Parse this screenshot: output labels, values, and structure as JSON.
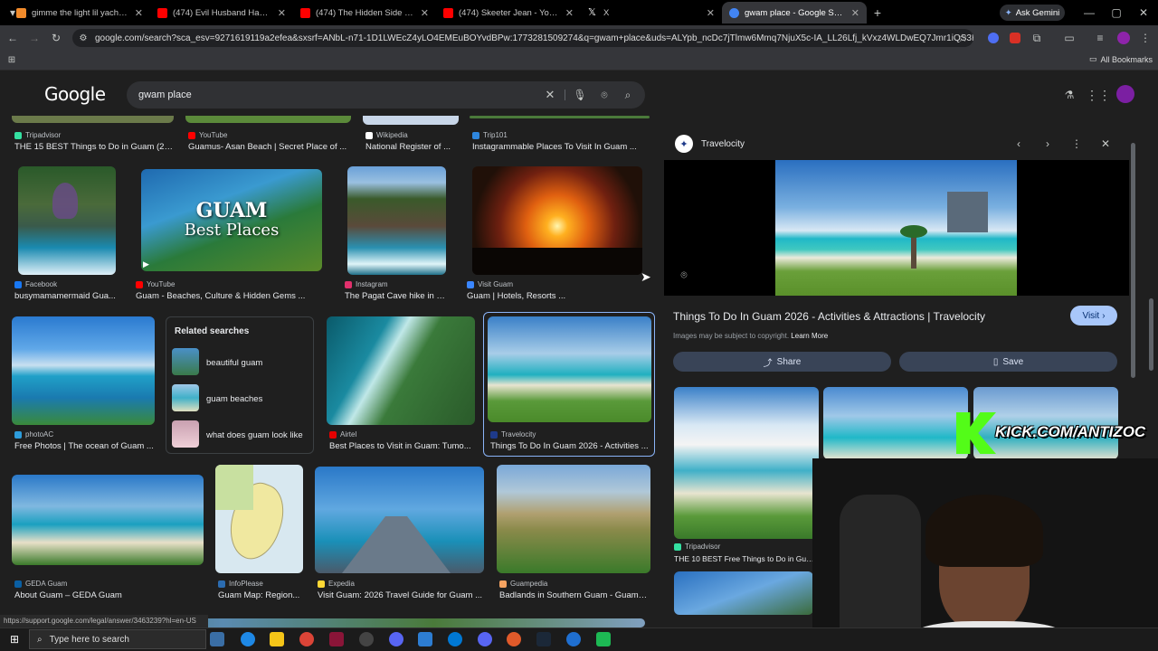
{
  "tabs": [
    {
      "title": "gimme the light lil yachty result",
      "color": "#f28b2b"
    },
    {
      "title": "(474) Evil Husband Has No Idea",
      "color": "#ff0000"
    },
    {
      "title": "(474) The Hidden Side of Japan",
      "color": "#ff0000"
    },
    {
      "title": "(474) Skeeter Jean - YouTube",
      "color": "#ff0000"
    },
    {
      "title": "X",
      "color": "#ffffff"
    },
    {
      "title": "gwam place - Google Search",
      "color": "#4285f4"
    }
  ],
  "browser": {
    "url": "google.com/search?sca_esv=9271619119a2efea&sxsrf=ANbL-n71-1D1LWEcZ4yLO4EMEuBOYvdBPw:1773281509274&q=gwam+place&uds=ALYpb_ncDc7jTlmw6Mmq7NjuX5c-IA_LL26Lfj_kVxz4WLDwEQ7Jmr1iQS3BOzk5WRLeQ...",
    "ask_gemini": "Ask Gemini",
    "all_bookmarks": "All Bookmarks",
    "status_url": "https://support.google.com/legal/answer/3463239?hl=en-US"
  },
  "google": {
    "logo": "Google",
    "query": "gwam place"
  },
  "top_row": [
    {
      "source": "Tripadvisor",
      "title": "THE 15 BEST Things to Do in Guam (20...",
      "color": "#34e0a1"
    },
    {
      "source": "YouTube",
      "title": "Guamus- Asan Beach | Secret Place of ...",
      "color": "#ff0000"
    },
    {
      "source": "Wikipedia",
      "title": "National Register of ...",
      "color": "#ffffff"
    },
    {
      "source": "Trip101",
      "title": "Instagrammable Places To Visit In Guam ...",
      "color": "#2e86de"
    }
  ],
  "row1": [
    {
      "source": "Facebook",
      "title": "busymamamermaid Gua...",
      "color": "#1877f2"
    },
    {
      "source": "YouTube",
      "title": "Guam - Beaches, Culture & Hidden Gems ...",
      "color": "#ff0000",
      "overlay1": "GUAM",
      "overlay2": "Best Places"
    },
    {
      "source": "Instagram",
      "title": "The Pagat Cave hike in G...",
      "color": "#e1306c"
    },
    {
      "source": "Visit Guam",
      "title": "Guam | Hotels, Resorts ...",
      "color": "#3a86ff"
    }
  ],
  "row2": [
    {
      "source": "photoAC",
      "title": "Free Photos | The ocean of Guam ...",
      "color": "#2d9cdb"
    },
    {
      "source": "Airtel",
      "title": "Best Places to Visit in Guam: Tumo...",
      "color": "#e40000"
    },
    {
      "source": "Travelocity",
      "title": "Things To Do In Guam 2026 - Activities ...",
      "color": "#1e3a8a"
    }
  ],
  "related": {
    "heading": "Related searches",
    "items": [
      "beautiful guam",
      "guam beaches",
      "what does guam look like"
    ]
  },
  "row3": [
    {
      "source": "GEDA Guam",
      "title": "About Guam – GEDA Guam",
      "color": "#0a5fa3"
    },
    {
      "source": "InfoPlease",
      "title": "Guam Map: Region...",
      "color": "#2b6cb0"
    },
    {
      "source": "Expedia",
      "title": "Visit Guam: 2026 Travel Guide for Guam ...",
      "color": "#fdd835"
    },
    {
      "source": "Guampedia",
      "title": "Badlands in Southern Guam - Guamp...",
      "color": "#f4a261"
    }
  ],
  "panel": {
    "source": "Travelocity",
    "title": "Things To Do In Guam 2026 - Activities & Attractions | Travelocity",
    "visit": "Visit",
    "copyright": "Images may be subject to copyright.",
    "learn_more": "Learn More",
    "share": "Share",
    "save": "Save",
    "related_source": "Tripadvisor",
    "related_title": "THE 10 BEST Free Things to Do in Guam"
  },
  "overlay": {
    "kick_text": "KICK.COM/ANTIZOC"
  },
  "taskbar": {
    "search_placeholder": "Type here to search"
  }
}
